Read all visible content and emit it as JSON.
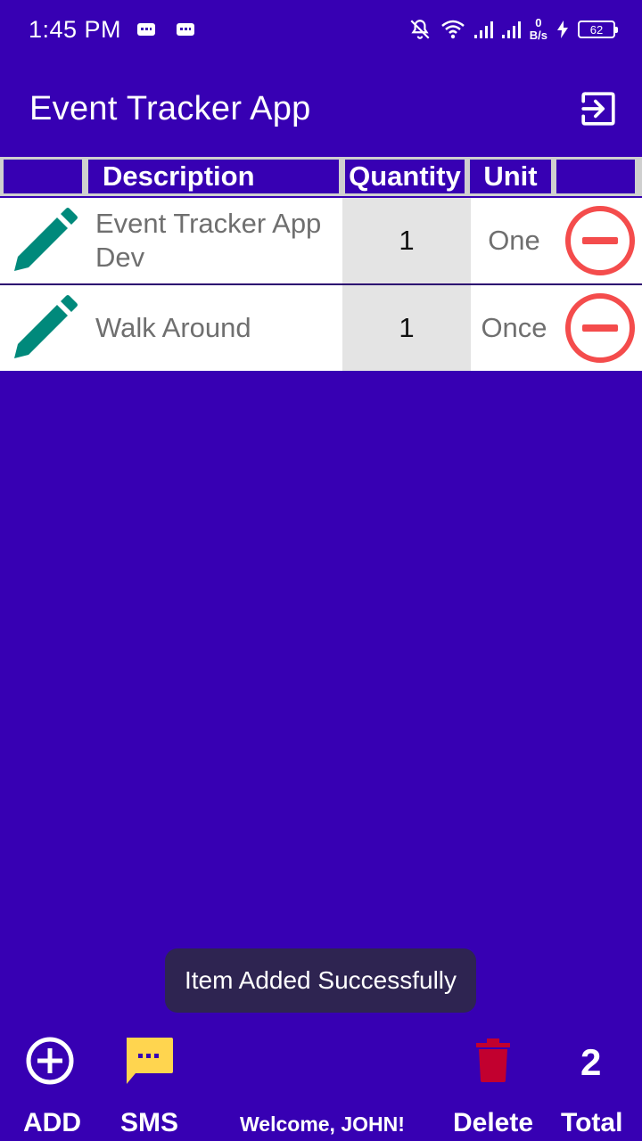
{
  "status_bar": {
    "time": "1:45 PM",
    "net_speed_value": "0",
    "net_speed_unit": "B/s",
    "battery": "62",
    "icons": [
      "chat-notification-icon",
      "chat-notification-icon",
      "bell-off-icon",
      "wifi-icon",
      "signal-icon",
      "signal-icon",
      "charging-icon",
      "battery-icon"
    ]
  },
  "app_bar": {
    "title": "Event Tracker App",
    "logout_icon": "logout-icon"
  },
  "table": {
    "headers": [
      "",
      "Description",
      "Quantity",
      "Unit",
      ""
    ],
    "rows": [
      {
        "description": "Event Tracker App Dev",
        "quantity": "1",
        "unit": "One"
      },
      {
        "description": "Walk Around",
        "quantity": "1",
        "unit": "Once"
      }
    ]
  },
  "toast": {
    "message": "Item Added Successfully"
  },
  "bottom_bar": {
    "add_label": "ADD",
    "sms_label": "SMS",
    "welcome": "Welcome, JOHN!",
    "delete_label": "Delete",
    "total_label": "Total",
    "total_count": "2"
  },
  "colors": {
    "background": "#3700B3",
    "edit_icon": "#00897B",
    "remove_icon": "#F44C4C",
    "sms_icon": "#FFD54F",
    "delete_icon": "#C2002F",
    "toast_bg": "#2E2451"
  }
}
